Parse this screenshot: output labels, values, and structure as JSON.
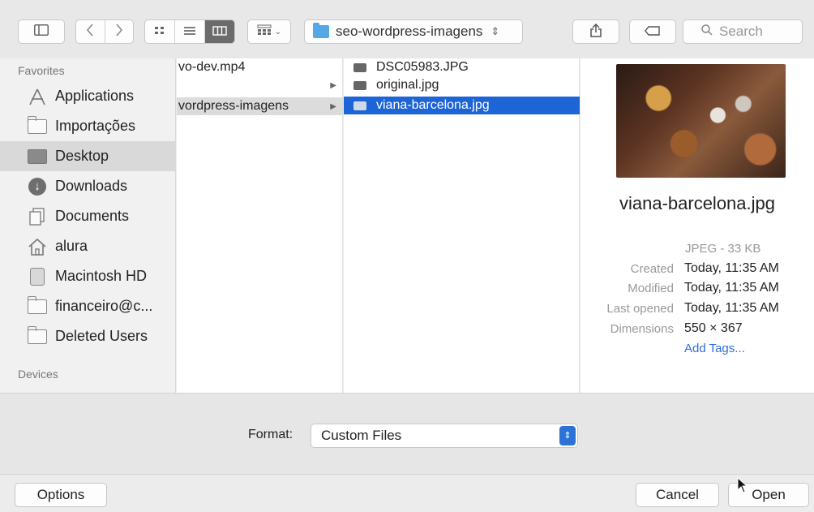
{
  "toolbar": {
    "path_label": "seo-wordpress-imagens",
    "path_chevron": "⌃⌄",
    "search_placeholder": "Search",
    "icons": [
      "sidebar-icon",
      "back-icon",
      "forward-icon",
      "icon-view-icon",
      "list-view-icon",
      "column-view-icon",
      "arrange-icon",
      "share-icon",
      "tag-icon",
      "search-icon"
    ]
  },
  "sidebar": {
    "favorites_heading": "Favorites",
    "items": [
      {
        "label": "Applications",
        "icon": "applications-icon"
      },
      {
        "label": "Importações",
        "icon": "folder-icon"
      },
      {
        "label": "Desktop",
        "icon": "desktop-icon"
      },
      {
        "label": "Downloads",
        "icon": "downloads-icon"
      },
      {
        "label": "Documents",
        "icon": "documents-icon"
      },
      {
        "label": "alura",
        "icon": "home-icon"
      },
      {
        "label": "Macintosh HD",
        "icon": "disk-icon"
      },
      {
        "label": "financeiro@c...",
        "icon": "folder-icon"
      },
      {
        "label": "Deleted Users",
        "icon": "folder-icon"
      }
    ],
    "devices_heading": "Devices"
  },
  "column1": {
    "items": [
      {
        "label": "vo-dev.mp4"
      },
      {
        "label": ""
      },
      {
        "label": "vordpress-imagens"
      }
    ]
  },
  "column2": {
    "items": [
      {
        "label": "DSC05983.JPG"
      },
      {
        "label": "original.jpg"
      },
      {
        "label": "viana-barcelona.jpg"
      }
    ]
  },
  "preview": {
    "filename": "viana-barcelona.jpg",
    "kind": "JPEG - 33 KB",
    "meta": [
      {
        "label": "Created",
        "value": "Today, 11:35 AM"
      },
      {
        "label": "Modified",
        "value": "Today, 11:35 AM"
      },
      {
        "label": "Last opened",
        "value": "Today, 11:35 AM"
      },
      {
        "label": "Dimensions",
        "value": "550 × 367"
      }
    ],
    "add_tags": "Add Tags..."
  },
  "format": {
    "label": "Format:",
    "selected": "Custom Files"
  },
  "buttons": {
    "options": "Options",
    "cancel": "Cancel",
    "open": "Open"
  }
}
